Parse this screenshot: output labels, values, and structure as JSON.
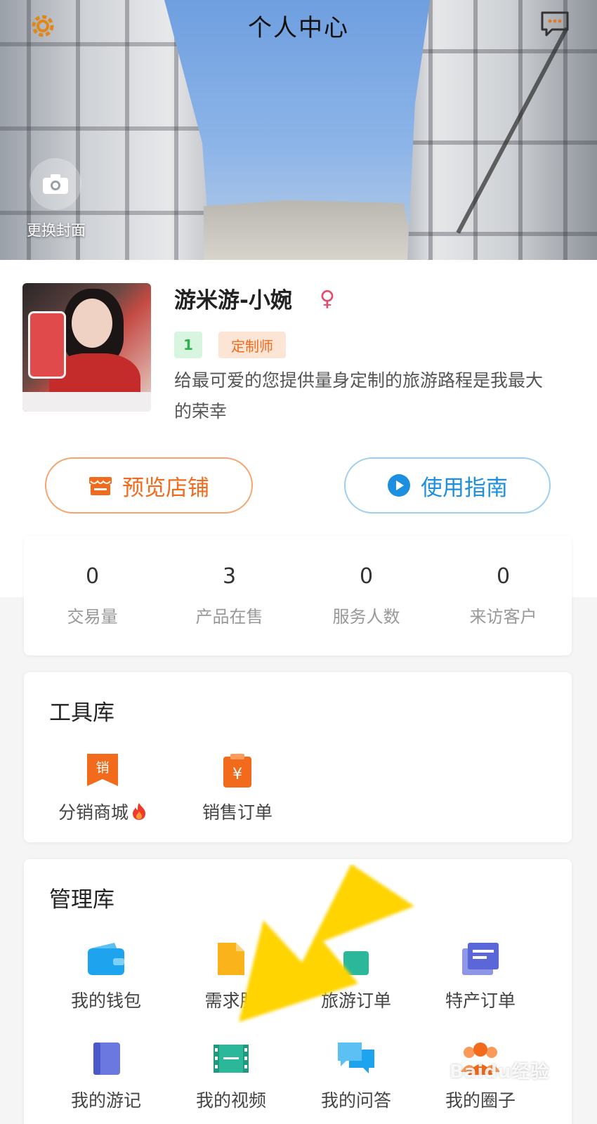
{
  "header": {
    "title": "个人中心",
    "settings_icon": "gear-icon",
    "message_icon": "chat-bubble-icon"
  },
  "cover": {
    "change_label": "更换封面"
  },
  "profile": {
    "name": "游米游-小婉",
    "gender_symbol": "♀",
    "level": "1",
    "role_tag": "定制师",
    "bio": "给最可爱的您提供量身定制的旅游路程是我最大的荣幸"
  },
  "actions": {
    "preview_shop": "预览店铺",
    "user_guide": "使用指南"
  },
  "stats": [
    {
      "value": "0",
      "label": "交易量"
    },
    {
      "value": "3",
      "label": "产品在售"
    },
    {
      "value": "0",
      "label": "服务人数"
    },
    {
      "value": "0",
      "label": "来访客户"
    }
  ],
  "tools": {
    "title": "工具库",
    "items": [
      {
        "label": "分销商城",
        "icon": "sale-bookmark-icon",
        "icon_text": "销"
      },
      {
        "label": "销售订单",
        "icon": "yuan-clipboard-icon",
        "icon_text": "¥"
      }
    ]
  },
  "manage": {
    "title": "管理库",
    "items": [
      {
        "label": "我的钱包",
        "icon": "wallet-icon"
      },
      {
        "label": "需求服",
        "icon": "document-icon"
      },
      {
        "label": "旅游订单",
        "icon": "travel-order-icon"
      },
      {
        "label": "特产订单",
        "icon": "stacked-list-icon"
      },
      {
        "label": "我的游记",
        "icon": "notebook-icon"
      },
      {
        "label": "我的视频",
        "icon": "film-icon"
      },
      {
        "label": "我的问答",
        "icon": "qa-bubbles-icon"
      },
      {
        "label": "我的圈子",
        "icon": "group-people-icon"
      }
    ]
  },
  "watermark": "Baidu经验",
  "colors": {
    "orange": "#f26a1b",
    "blue": "#1c8fe0",
    "green": "#31b14e",
    "annotation_yellow": "#ffd400"
  }
}
